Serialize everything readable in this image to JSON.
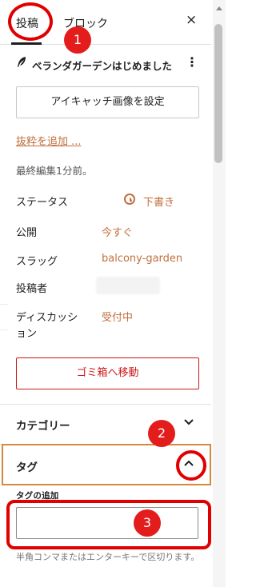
{
  "tabs": {
    "post": "投稿",
    "block": "ブロック"
  },
  "close_icon": "×",
  "post": {
    "icon": "feather-icon",
    "title": "ベランダガーデンはじめました",
    "more_icon": "⋮"
  },
  "featured_image_button": "アイキャッチ画像を設定",
  "excerpt_link": "抜粋を追加 ...",
  "last_edited": "最終編集1分前。",
  "summary": {
    "status": {
      "label": "ステータス",
      "value": "下書き"
    },
    "publish": {
      "label": "公開",
      "value": "今すぐ"
    },
    "slug": {
      "label": "スラッグ",
      "value": "balcony-garden"
    },
    "author": {
      "label": "投稿者"
    },
    "discussion": {
      "label_line1": "ディスカッシ",
      "label_line2": "ョン",
      "value": "受付中"
    }
  },
  "trash_button": "ゴミ箱へ移動",
  "sections": {
    "categories": {
      "title": "カテゴリー",
      "chevron": "chevron-down-icon"
    },
    "tags": {
      "title": "タグ",
      "chevron": "chevron-up-icon"
    }
  },
  "tag_input": {
    "label": "タグの追加",
    "value": ""
  },
  "tag_help": "半角コンマまたはエンターキーで区切ります。",
  "annotations": {
    "badge1": "1",
    "badge2": "2",
    "badge3": "3"
  },
  "colors": {
    "accent_orange": "#c16f3e",
    "danger_red": "#cc1818",
    "annotation_red": "#e31c1c",
    "focus_orange": "#d38a3e"
  }
}
